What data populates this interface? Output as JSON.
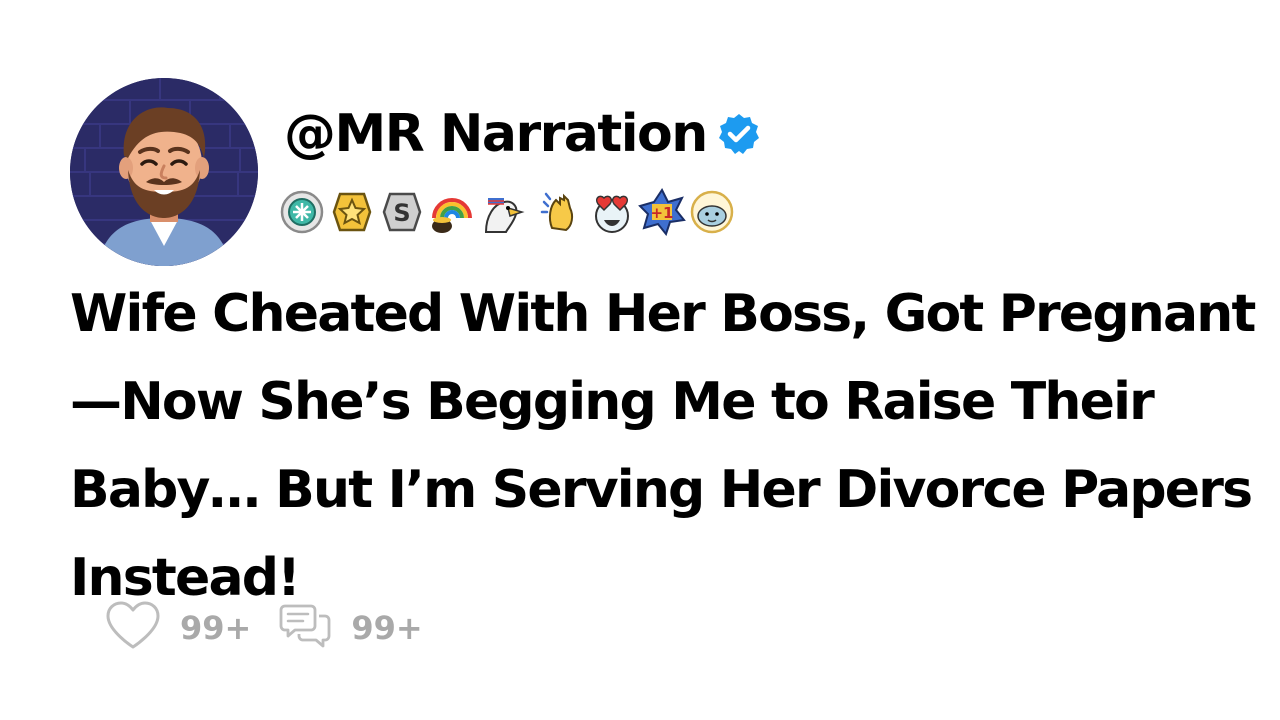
{
  "post": {
    "username": "@MR Narration",
    "verified": true,
    "title": "Wife Cheated With Her Boss, Got Pregnant—Now She’s Begging Me to Raise Their Baby… But I’m Serving Her Divorce Papers Instead!",
    "likes_count": "99+",
    "comments_count": "99+"
  },
  "badges": [
    "helpful-award-icon",
    "gold-star-award-icon",
    "silver-award-icon",
    "rainbow-pot-of-gold-icon",
    "eagle-icon",
    "clapping-hands-icon",
    "heart-eyes-icon",
    "plus-one-icon",
    "seal-icon"
  ],
  "icons": {
    "heart": "heart-outline-icon",
    "comment": "comment-bubbles-icon",
    "verified": "verified-check-icon"
  },
  "colors": {
    "verified_blue": "#1d9bf0",
    "stat_gray": "#a9a9a9",
    "avatar_background": "#2a2960"
  }
}
